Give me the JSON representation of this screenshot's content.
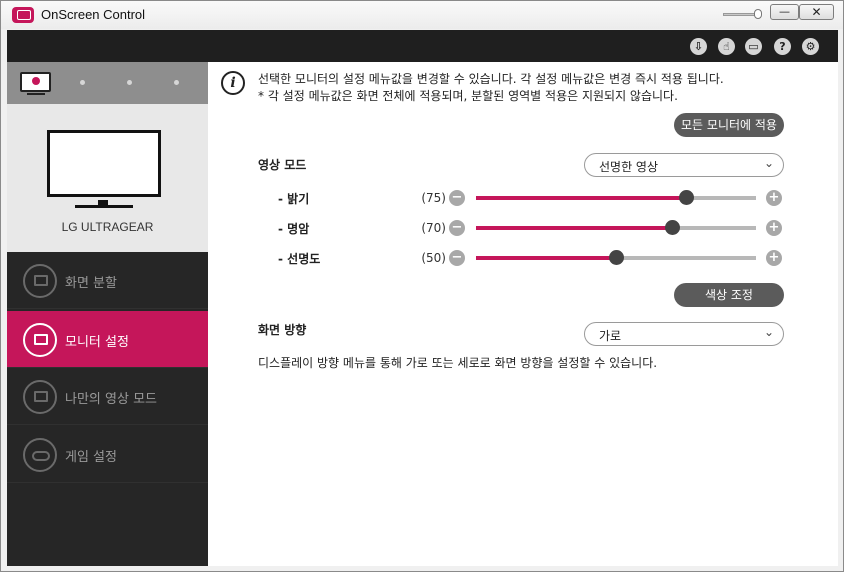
{
  "window": {
    "title": "OnScreen Control",
    "minimize_glyph": "—",
    "close_glyph": "✕",
    "accent_color": "#c5165a"
  },
  "toolbar": {
    "icons": [
      "download-icon",
      "pointer-icon",
      "display-icon",
      "help-icon",
      "settings-icon"
    ],
    "glyphs": [
      "⇩",
      "☝",
      "▭",
      "?",
      "⚙"
    ]
  },
  "sidebar": {
    "monitor_name": "LG ULTRAGEAR",
    "items": [
      {
        "label": "화면 분할",
        "icon": "split-screen-icon",
        "active": false
      },
      {
        "label": "모니터 설정",
        "icon": "monitor-settings-icon",
        "active": true
      },
      {
        "label": "나만의 영상 모드",
        "icon": "picture-mode-icon",
        "active": false
      },
      {
        "label": "게임 설정",
        "icon": "gamepad-icon",
        "active": false
      }
    ]
  },
  "main": {
    "info_line1": "선택한 모니터의 설정 메뉴값을 변경할 수 있습니다. 각 설정 메뉴값은 변경 즉시 적용 됩니다.",
    "info_line2": "* 각 설정 메뉴값은 화면 전체에 적용되며, 분할된 영역별 적용은 지원되지 않습니다.",
    "apply_all_label": "모든 모니터에 적용",
    "picture_mode": {
      "label": "영상 모드",
      "value": "선명한 영상"
    },
    "sliders": [
      {
        "label": "- 밝기",
        "display": "(75)",
        "value": 75
      },
      {
        "label": "- 명암",
        "display": "(70)",
        "value": 70
      },
      {
        "label": "- 선명도",
        "display": "(50)",
        "value": 50
      }
    ],
    "minus_glyph": "−",
    "plus_glyph": "+",
    "color_adjust_label": "색상 조정",
    "orientation": {
      "label": "화면 방향",
      "value": "가로",
      "description": "디스플레이 방향 메뉴를 통해 가로 또는 세로로 화면 방향을 설정할 수 있습니다."
    }
  }
}
